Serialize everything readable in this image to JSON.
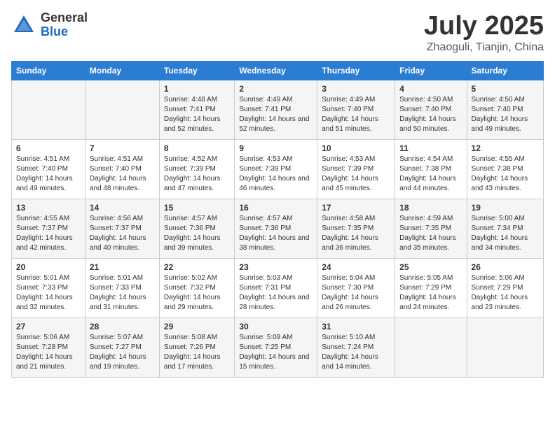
{
  "logo": {
    "general": "General",
    "blue": "Blue"
  },
  "title": "July 2025",
  "subtitle": "Zhaoguli, Tianjin, China",
  "weekdays": [
    "Sunday",
    "Monday",
    "Tuesday",
    "Wednesday",
    "Thursday",
    "Friday",
    "Saturday"
  ],
  "weeks": [
    [
      {
        "day": "",
        "info": ""
      },
      {
        "day": "",
        "info": ""
      },
      {
        "day": "1",
        "info": "Sunrise: 4:48 AM\nSunset: 7:41 PM\nDaylight: 14 hours and 52 minutes."
      },
      {
        "day": "2",
        "info": "Sunrise: 4:49 AM\nSunset: 7:41 PM\nDaylight: 14 hours and 52 minutes."
      },
      {
        "day": "3",
        "info": "Sunrise: 4:49 AM\nSunset: 7:40 PM\nDaylight: 14 hours and 51 minutes."
      },
      {
        "day": "4",
        "info": "Sunrise: 4:50 AM\nSunset: 7:40 PM\nDaylight: 14 hours and 50 minutes."
      },
      {
        "day": "5",
        "info": "Sunrise: 4:50 AM\nSunset: 7:40 PM\nDaylight: 14 hours and 49 minutes."
      }
    ],
    [
      {
        "day": "6",
        "info": "Sunrise: 4:51 AM\nSunset: 7:40 PM\nDaylight: 14 hours and 49 minutes."
      },
      {
        "day": "7",
        "info": "Sunrise: 4:51 AM\nSunset: 7:40 PM\nDaylight: 14 hours and 48 minutes."
      },
      {
        "day": "8",
        "info": "Sunrise: 4:52 AM\nSunset: 7:39 PM\nDaylight: 14 hours and 47 minutes."
      },
      {
        "day": "9",
        "info": "Sunrise: 4:53 AM\nSunset: 7:39 PM\nDaylight: 14 hours and 46 minutes."
      },
      {
        "day": "10",
        "info": "Sunrise: 4:53 AM\nSunset: 7:39 PM\nDaylight: 14 hours and 45 minutes."
      },
      {
        "day": "11",
        "info": "Sunrise: 4:54 AM\nSunset: 7:38 PM\nDaylight: 14 hours and 44 minutes."
      },
      {
        "day": "12",
        "info": "Sunrise: 4:55 AM\nSunset: 7:38 PM\nDaylight: 14 hours and 43 minutes."
      }
    ],
    [
      {
        "day": "13",
        "info": "Sunrise: 4:55 AM\nSunset: 7:37 PM\nDaylight: 14 hours and 42 minutes."
      },
      {
        "day": "14",
        "info": "Sunrise: 4:56 AM\nSunset: 7:37 PM\nDaylight: 14 hours and 40 minutes."
      },
      {
        "day": "15",
        "info": "Sunrise: 4:57 AM\nSunset: 7:36 PM\nDaylight: 14 hours and 39 minutes."
      },
      {
        "day": "16",
        "info": "Sunrise: 4:57 AM\nSunset: 7:36 PM\nDaylight: 14 hours and 38 minutes."
      },
      {
        "day": "17",
        "info": "Sunrise: 4:58 AM\nSunset: 7:35 PM\nDaylight: 14 hours and 36 minutes."
      },
      {
        "day": "18",
        "info": "Sunrise: 4:59 AM\nSunset: 7:35 PM\nDaylight: 14 hours and 35 minutes."
      },
      {
        "day": "19",
        "info": "Sunrise: 5:00 AM\nSunset: 7:34 PM\nDaylight: 14 hours and 34 minutes."
      }
    ],
    [
      {
        "day": "20",
        "info": "Sunrise: 5:01 AM\nSunset: 7:33 PM\nDaylight: 14 hours and 32 minutes."
      },
      {
        "day": "21",
        "info": "Sunrise: 5:01 AM\nSunset: 7:33 PM\nDaylight: 14 hours and 31 minutes."
      },
      {
        "day": "22",
        "info": "Sunrise: 5:02 AM\nSunset: 7:32 PM\nDaylight: 14 hours and 29 minutes."
      },
      {
        "day": "23",
        "info": "Sunrise: 5:03 AM\nSunset: 7:31 PM\nDaylight: 14 hours and 28 minutes."
      },
      {
        "day": "24",
        "info": "Sunrise: 5:04 AM\nSunset: 7:30 PM\nDaylight: 14 hours and 26 minutes."
      },
      {
        "day": "25",
        "info": "Sunrise: 5:05 AM\nSunset: 7:29 PM\nDaylight: 14 hours and 24 minutes."
      },
      {
        "day": "26",
        "info": "Sunrise: 5:06 AM\nSunset: 7:29 PM\nDaylight: 14 hours and 23 minutes."
      }
    ],
    [
      {
        "day": "27",
        "info": "Sunrise: 5:06 AM\nSunset: 7:28 PM\nDaylight: 14 hours and 21 minutes."
      },
      {
        "day": "28",
        "info": "Sunrise: 5:07 AM\nSunset: 7:27 PM\nDaylight: 14 hours and 19 minutes."
      },
      {
        "day": "29",
        "info": "Sunrise: 5:08 AM\nSunset: 7:26 PM\nDaylight: 14 hours and 17 minutes."
      },
      {
        "day": "30",
        "info": "Sunrise: 5:09 AM\nSunset: 7:25 PM\nDaylight: 14 hours and 15 minutes."
      },
      {
        "day": "31",
        "info": "Sunrise: 5:10 AM\nSunset: 7:24 PM\nDaylight: 14 hours and 14 minutes."
      },
      {
        "day": "",
        "info": ""
      },
      {
        "day": "",
        "info": ""
      }
    ]
  ]
}
